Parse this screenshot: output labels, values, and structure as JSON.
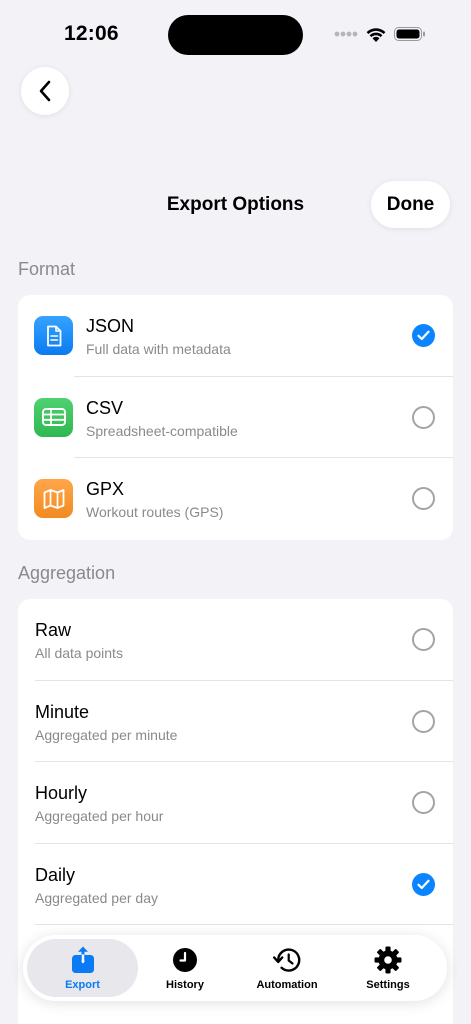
{
  "status_bar": {
    "time": "12:06"
  },
  "nav": {
    "title": "Export Options",
    "done_label": "Done"
  },
  "format": {
    "header": "Format",
    "options": [
      {
        "title": "JSON",
        "subtitle": "Full data with metadata",
        "icon": "document-icon",
        "icon_color": "#1a8cf0",
        "selected": true
      },
      {
        "title": "CSV",
        "subtitle": "Spreadsheet-compatible",
        "icon": "table-icon",
        "icon_color": "#34c759",
        "selected": false
      },
      {
        "title": "GPX",
        "subtitle": "Workout routes (GPS)",
        "icon": "map-icon",
        "icon_color": "#f5922f",
        "selected": false
      }
    ]
  },
  "aggregation": {
    "header": "Aggregation",
    "options": [
      {
        "title": "Raw",
        "subtitle": "All data points",
        "selected": false
      },
      {
        "title": "Minute",
        "subtitle": "Aggregated per minute",
        "selected": false
      },
      {
        "title": "Hourly",
        "subtitle": "Aggregated per hour",
        "selected": false
      },
      {
        "title": "Daily",
        "subtitle": "Aggregated per day",
        "selected": true
      }
    ]
  },
  "tabs": [
    {
      "label": "Export",
      "icon": "export-icon",
      "active": true
    },
    {
      "label": "History",
      "icon": "clock-icon",
      "active": false
    },
    {
      "label": "Automation",
      "icon": "history-arrow-icon",
      "active": false
    },
    {
      "label": "Settings",
      "icon": "gear-icon",
      "active": false
    }
  ],
  "colors": {
    "accent": "#0a84ff",
    "background": "#f2f2f7"
  }
}
